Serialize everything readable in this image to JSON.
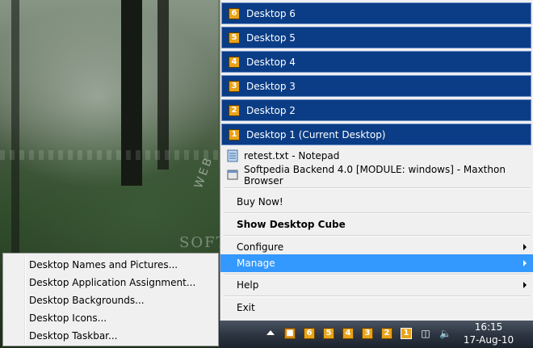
{
  "desktops": [
    {
      "num": "6",
      "label": "Desktop 6"
    },
    {
      "num": "5",
      "label": "Desktop 5"
    },
    {
      "num": "4",
      "label": "Desktop 4"
    },
    {
      "num": "3",
      "label": "Desktop 3"
    },
    {
      "num": "2",
      "label": "Desktop 2"
    },
    {
      "num": "1",
      "label": "Desktop 1 (Current Desktop)"
    }
  ],
  "windows": [
    {
      "label": "retest.txt - Notepad",
      "icon": "notepad-icon"
    },
    {
      "label": "Softpedia Backend 4.0 [MODULE: windows] - Maxthon Browser",
      "icon": "browser-icon"
    }
  ],
  "menu": {
    "buy": "Buy Now!",
    "cube": "Show Desktop Cube",
    "configure": "Configure",
    "manage": "Manage",
    "help": "Help",
    "exit": "Exit"
  },
  "submenu": [
    "Desktop Names and Pictures...",
    "Desktop Application Assignment...",
    "Desktop Backgrounds...",
    "Desktop Icons...",
    "Desktop Taskbar..."
  ],
  "watermark": {
    "web": "WEB",
    "soft": "SOFTPEDIA"
  },
  "taskbar": {
    "tray_numbers": [
      "6",
      "5",
      "4",
      "3",
      "2",
      "1"
    ],
    "time": "16:15",
    "date": "17-Aug-10"
  },
  "colors": {
    "desktop_item_bg": "#0b3d86",
    "highlight": "#3399ff",
    "badge": "#e9a318"
  }
}
